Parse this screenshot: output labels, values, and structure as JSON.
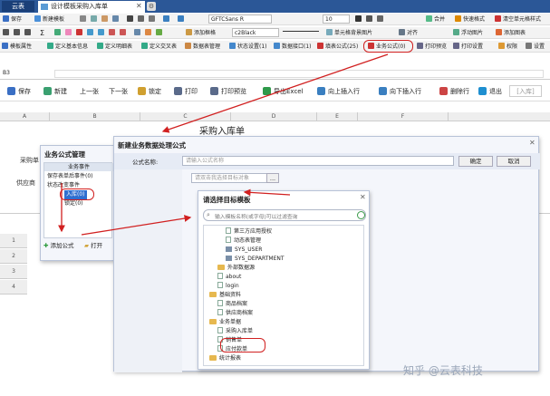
{
  "tabbar": {
    "brand": "云表",
    "tab_label": "设计模板采购入库单",
    "close": "✕",
    "settings": "⚙"
  },
  "toolbar1": {
    "save": "保存",
    "new_template": "新建模板",
    "font_name": "GFTCSans R",
    "font_size": "10",
    "merge": "合并",
    "quick_format": "快速格式",
    "clear_format": "清空单元格样式"
  },
  "toolbar2": {
    "sigma": "Σ",
    "template_frame": "添加框格",
    "font_color": "c2Black",
    "cell_bg": "单元格背景图片",
    "float_image": "浮动图片",
    "align": "对齐",
    "add_chart": "添加图表"
  },
  "toolbar3": {
    "template_props": "模板属性",
    "define_basic": "定义基本信息",
    "define_detail": "定义明细表",
    "define_cross": "定义交叉表",
    "data_table_manage": "数据表管理",
    "status_settings": "状态设置(1)",
    "data_interface": "数据接口(1)",
    "fill_formula": "填表公式(25)",
    "business_formula": "业务公式(0)",
    "print_preview": "打印预览",
    "print_settings": "打印设置",
    "permission": "权限",
    "settings": "设置"
  },
  "formula_bar": {
    "cell": "B3"
  },
  "action_bar": {
    "save": "保存",
    "new": "新建",
    "prev": "上一张",
    "next": "下一张",
    "lock": "锁定",
    "print": "打印",
    "print_preview": "打印预览",
    "export": "导出Excel",
    "insert_up": "向上插入行",
    "insert_down": "向下插入行",
    "delete_row": "删除行",
    "exit": "退出",
    "enter": "[入库]"
  },
  "sheet": {
    "col_headers": [
      "A",
      "B",
      "C",
      "D",
      "E",
      "F"
    ],
    "title": "采购入库单",
    "row_label_purchase": "采购单",
    "row_label_supplier": "供应商",
    "row_numbers": [
      "1",
      "2",
      "3",
      "4"
    ]
  },
  "formula_mgmt": {
    "title": "业务公式管理",
    "header": "业务事件",
    "items": [
      "保存表单后事件(0)",
      "状态改变事件",
      "入库(0)",
      "锁定(0)"
    ],
    "add_formula": "添加公式",
    "open": "打开"
  },
  "new_formula": {
    "title": "新建业务数据处理公式",
    "name_label": "公式名称:",
    "name_placeholder": "请输入公式名称",
    "ok": "确定",
    "cancel": "取消",
    "target_placeholder": "请双击我选择目标对象",
    "more": "..."
  },
  "select_template": {
    "title": "请选择目标模板",
    "search_placeholder": "输入模板名称(或字母)可以过滤查询",
    "tree": [
      {
        "label": "第三方应用授权",
        "kind": "page",
        "indent": 2
      },
      {
        "label": "动态表管理",
        "kind": "page",
        "indent": 2
      },
      {
        "label": "SYS_USER",
        "kind": "db",
        "indent": 2
      },
      {
        "label": "SYS_DEPARTMENT",
        "kind": "db",
        "indent": 2
      },
      {
        "label": "外部数据源",
        "kind": "folder",
        "indent": 1
      },
      {
        "label": "about",
        "kind": "page",
        "indent": 1
      },
      {
        "label": "login",
        "kind": "page",
        "indent": 1
      },
      {
        "label": "基础资料",
        "kind": "folder",
        "indent": 0
      },
      {
        "label": "商品档案",
        "kind": "page",
        "indent": 1
      },
      {
        "label": "供应商档案",
        "kind": "page",
        "indent": 1
      },
      {
        "label": "业务单据",
        "kind": "folder",
        "indent": 0
      },
      {
        "label": "采购入库单",
        "kind": "page",
        "indent": 1
      },
      {
        "label": "销售单",
        "kind": "page",
        "indent": 1
      },
      {
        "label": "应付款单",
        "kind": "page",
        "indent": 1
      },
      {
        "label": "统计报表",
        "kind": "folder",
        "indent": 0
      }
    ]
  },
  "watermark": "知乎 @云表科技",
  "colors": {
    "tabbar": "#2b5797",
    "highlight": "#d12020",
    "selected": "#2f6fd0"
  }
}
